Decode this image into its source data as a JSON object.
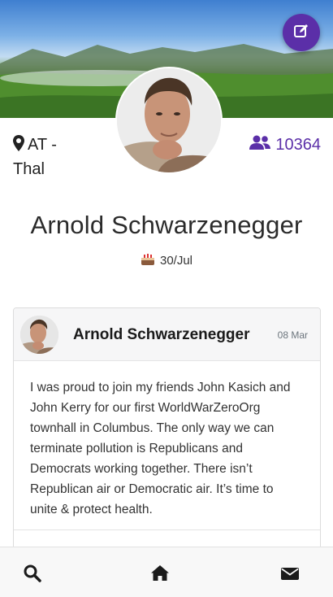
{
  "header": {
    "cover_image": "landscape-cover",
    "edit_button_icon": "edit-icon"
  },
  "profile": {
    "avatar": "profile-photo",
    "location": "AT - Thal",
    "followers": "10364",
    "name": "Arnold Schwarzenegger",
    "birthday": "30/Jul"
  },
  "post": {
    "author": "Arnold Schwarzenegger",
    "date": "08 Mar",
    "text": "I was proud to join my friends John Kasich and John Kerry for our first WorldWarZeroOrg townhall in Columbus. The only way we can terminate pollution is Republicans and Democrats working together. There isn’t Republican air or Democratic air. It’s time to unite & protect health."
  },
  "bottom_nav": {
    "items": [
      "search-icon",
      "home-icon",
      "envelope-icon"
    ]
  },
  "colors": {
    "accent": "#5b2fa8",
    "text": "#212529"
  }
}
